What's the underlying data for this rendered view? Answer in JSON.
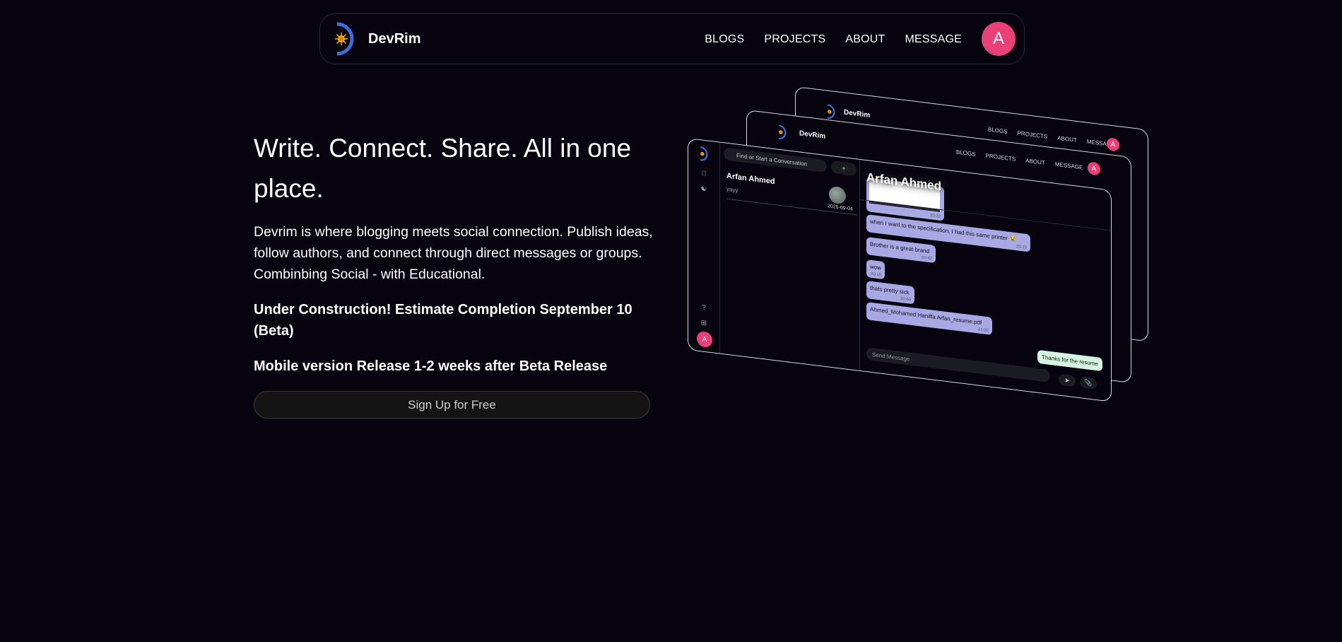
{
  "nav": {
    "brand": "DevRim",
    "links": [
      "BLOGS",
      "PROJECTS",
      "ABOUT",
      "MESSAGE"
    ],
    "avatar_initial": "A"
  },
  "hero": {
    "title": "Write. Connect. Share. All in one place.",
    "description": "Devrim is where blogging meets social connection. Publish ideas, follow authors, and connect through direct messages or groups. Combinbing Social - with Educational.",
    "notice_construction": "Under Construction! Estimate Completion September 10 (Beta)",
    "notice_mobile": "Mobile version Release 1-2 weeks after Beta Release",
    "signup_label": "Sign Up for Free"
  },
  "preview": {
    "mini_brand": "DevRim",
    "mini_links": [
      "BLOGS",
      "PROJECTS",
      "ABOUT",
      "MESSAGE"
    ],
    "mini_avatar": "A",
    "search_placeholder": "Find or Start a Conversation",
    "add_label": "+",
    "conversation": {
      "name": "Arfan Ahmed",
      "last_message": "yayy",
      "date": "2025-09-04"
    },
    "chat_title": "Arfan Ahmed",
    "messages": [
      {
        "text": "when I want to the specification, I had this same printer 😭",
        "time": "20:23"
      },
      {
        "text": "Brother is a great brand",
        "time": "20:42"
      },
      {
        "text": "wow",
        "time": "20:15"
      },
      {
        "text": "thats pretty sick",
        "time": "20:50"
      },
      {
        "text": "Ahmed_Mohamed Haniffa Arfan_resume.pdf",
        "time": "21:02"
      }
    ],
    "image_time": "20:22",
    "my_message": "Thanks for the resume",
    "composer_placeholder": "Send Message",
    "sidebar_avatar": "A"
  },
  "colors": {
    "background": "#07030f",
    "accent_pink": "#e9407a",
    "bubble_purple": "#a7a8e4",
    "bubble_green": "#d6f5e0"
  }
}
